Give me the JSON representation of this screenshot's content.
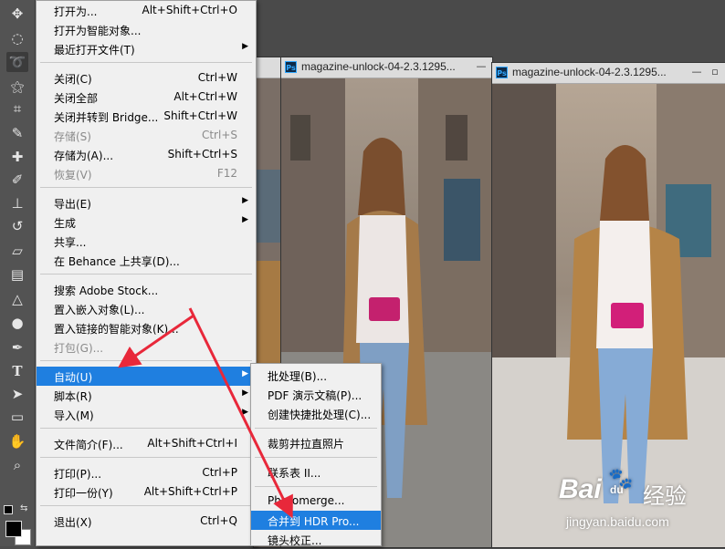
{
  "toolbar": {
    "tools": [
      "move-tool",
      "marquee-tool",
      "lasso-tool",
      "magic-wand-tool",
      "crop-tool",
      "eyedropper-tool",
      "healing-brush-tool",
      "brush-tool",
      "clone-stamp-tool",
      "history-brush-tool",
      "eraser-tool",
      "gradient-tool",
      "blur-tool",
      "dodge-tool",
      "pen-tool",
      "type-tool",
      "path-selection-tool",
      "rectangle-tool",
      "hand-tool",
      "zoom-tool"
    ],
    "foreground_color": "#000000",
    "background_color": "#ffffff"
  },
  "documents": [
    {
      "title": "magazine-unlock-04-2.3.1295..."
    },
    {
      "title": "magazine-unlock-04-2.3.1295..."
    }
  ],
  "file_menu": {
    "items": [
      {
        "label": "打开为...",
        "shortcut": "Alt+Shift+Ctrl+O",
        "disabled": false,
        "submenu": false
      },
      {
        "label": "打开为智能对象...",
        "shortcut": "",
        "disabled": false,
        "submenu": false
      },
      {
        "label": "最近打开文件(T)",
        "shortcut": "",
        "disabled": false,
        "submenu": true
      },
      {
        "label": "关闭(C)",
        "shortcut": "Ctrl+W",
        "disabled": false,
        "submenu": false
      },
      {
        "label": "关闭全部",
        "shortcut": "Alt+Ctrl+W",
        "disabled": false,
        "submenu": false
      },
      {
        "label": "关闭并转到 Bridge...",
        "shortcut": "Shift+Ctrl+W",
        "disabled": false,
        "submenu": false
      },
      {
        "label": "存储(S)",
        "shortcut": "Ctrl+S",
        "disabled": true,
        "submenu": false
      },
      {
        "label": "存储为(A)...",
        "shortcut": "Shift+Ctrl+S",
        "disabled": false,
        "submenu": false
      },
      {
        "label": "恢复(V)",
        "shortcut": "F12",
        "disabled": true,
        "submenu": false
      },
      {
        "label": "导出(E)",
        "shortcut": "",
        "disabled": false,
        "submenu": true
      },
      {
        "label": "生成",
        "shortcut": "",
        "disabled": false,
        "submenu": true
      },
      {
        "label": "共享...",
        "shortcut": "",
        "disabled": false,
        "submenu": false
      },
      {
        "label": "在 Behance 上共享(D)...",
        "shortcut": "",
        "disabled": false,
        "submenu": false
      },
      {
        "label": "搜索 Adobe Stock...",
        "shortcut": "",
        "disabled": false,
        "submenu": false
      },
      {
        "label": "置入嵌入对象(L)...",
        "shortcut": "",
        "disabled": false,
        "submenu": false
      },
      {
        "label": "置入链接的智能对象(K)...",
        "shortcut": "",
        "disabled": false,
        "submenu": false
      },
      {
        "label": "打包(G)...",
        "shortcut": "",
        "disabled": true,
        "submenu": false
      },
      {
        "label": "自动(U)",
        "shortcut": "",
        "disabled": false,
        "submenu": true
      },
      {
        "label": "脚本(R)",
        "shortcut": "",
        "disabled": false,
        "submenu": true
      },
      {
        "label": "导入(M)",
        "shortcut": "",
        "disabled": false,
        "submenu": true
      },
      {
        "label": "文件简介(F)...",
        "shortcut": "Alt+Shift+Ctrl+I",
        "disabled": false,
        "submenu": false
      },
      {
        "label": "打印(P)...",
        "shortcut": "Ctrl+P",
        "disabled": false,
        "submenu": false
      },
      {
        "label": "打印一份(Y)",
        "shortcut": "Alt+Shift+Ctrl+P",
        "disabled": false,
        "submenu": false
      },
      {
        "label": "退出(X)",
        "shortcut": "Ctrl+Q",
        "disabled": false,
        "submenu": false
      }
    ]
  },
  "automate_menu": {
    "items": [
      {
        "label": "批处理(B)..."
      },
      {
        "label": "PDF 演示文稿(P)..."
      },
      {
        "label": "创建快捷批处理(C)..."
      },
      {
        "label": "裁剪并拉直照片"
      },
      {
        "label": "联系表 II..."
      },
      {
        "label": "Photomerge..."
      },
      {
        "label": "合并到 HDR Pro..."
      },
      {
        "label": "镜头校正..."
      }
    ]
  },
  "watermark": {
    "brand": "Bai",
    "paw": "du",
    "suffix": "经验",
    "url": "jingyan.baidu.com"
  },
  "colors": {
    "menu_bg": "#f0f0f0",
    "highlight": "#1f7fe0",
    "arrow": "#e8283a",
    "toolbar_bg": "#535353"
  }
}
